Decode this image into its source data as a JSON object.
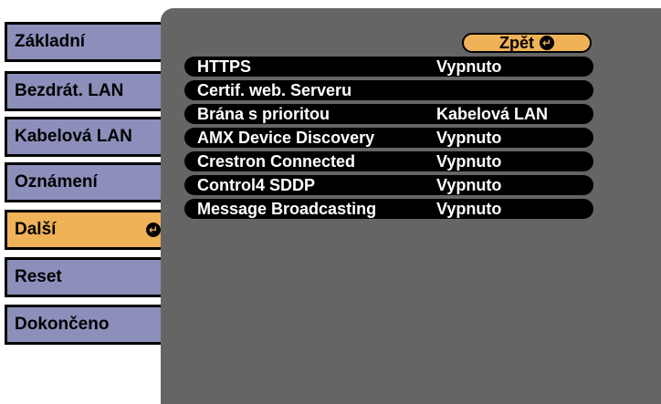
{
  "sidebar": {
    "items": [
      {
        "label": "Základní",
        "active": false
      },
      {
        "label": "Bezdrát. LAN",
        "active": false
      },
      {
        "label": "Kabelová LAN",
        "active": false
      },
      {
        "label": "Oznámení",
        "active": false
      },
      {
        "label": "Další",
        "active": true
      },
      {
        "label": "Reset",
        "active": false
      },
      {
        "label": "Dokončeno",
        "active": false
      }
    ]
  },
  "panel": {
    "back_label": "Zpět",
    "rows": [
      {
        "label": "HTTPS",
        "value": "Vypnuto"
      },
      {
        "label": "Certif. web. Serveru",
        "value": ""
      },
      {
        "label": "Brána s prioritou",
        "value": "Kabelová LAN"
      },
      {
        "label": "AMX Device Discovery",
        "value": "Vypnuto"
      },
      {
        "label": "Crestron Connected",
        "value": "Vypnuto"
      },
      {
        "label": "Control4 SDDP",
        "value": "Vypnuto"
      },
      {
        "label": "Message Broadcasting",
        "value": "Vypnuto"
      }
    ]
  },
  "colors": {
    "tab_inactive": "#8c8fba",
    "tab_active": "#f0b257",
    "panel_bg": "#656565",
    "row_bg": "#000000",
    "row_text": "#ffffff"
  },
  "icons": {
    "enter": "enter-icon"
  }
}
